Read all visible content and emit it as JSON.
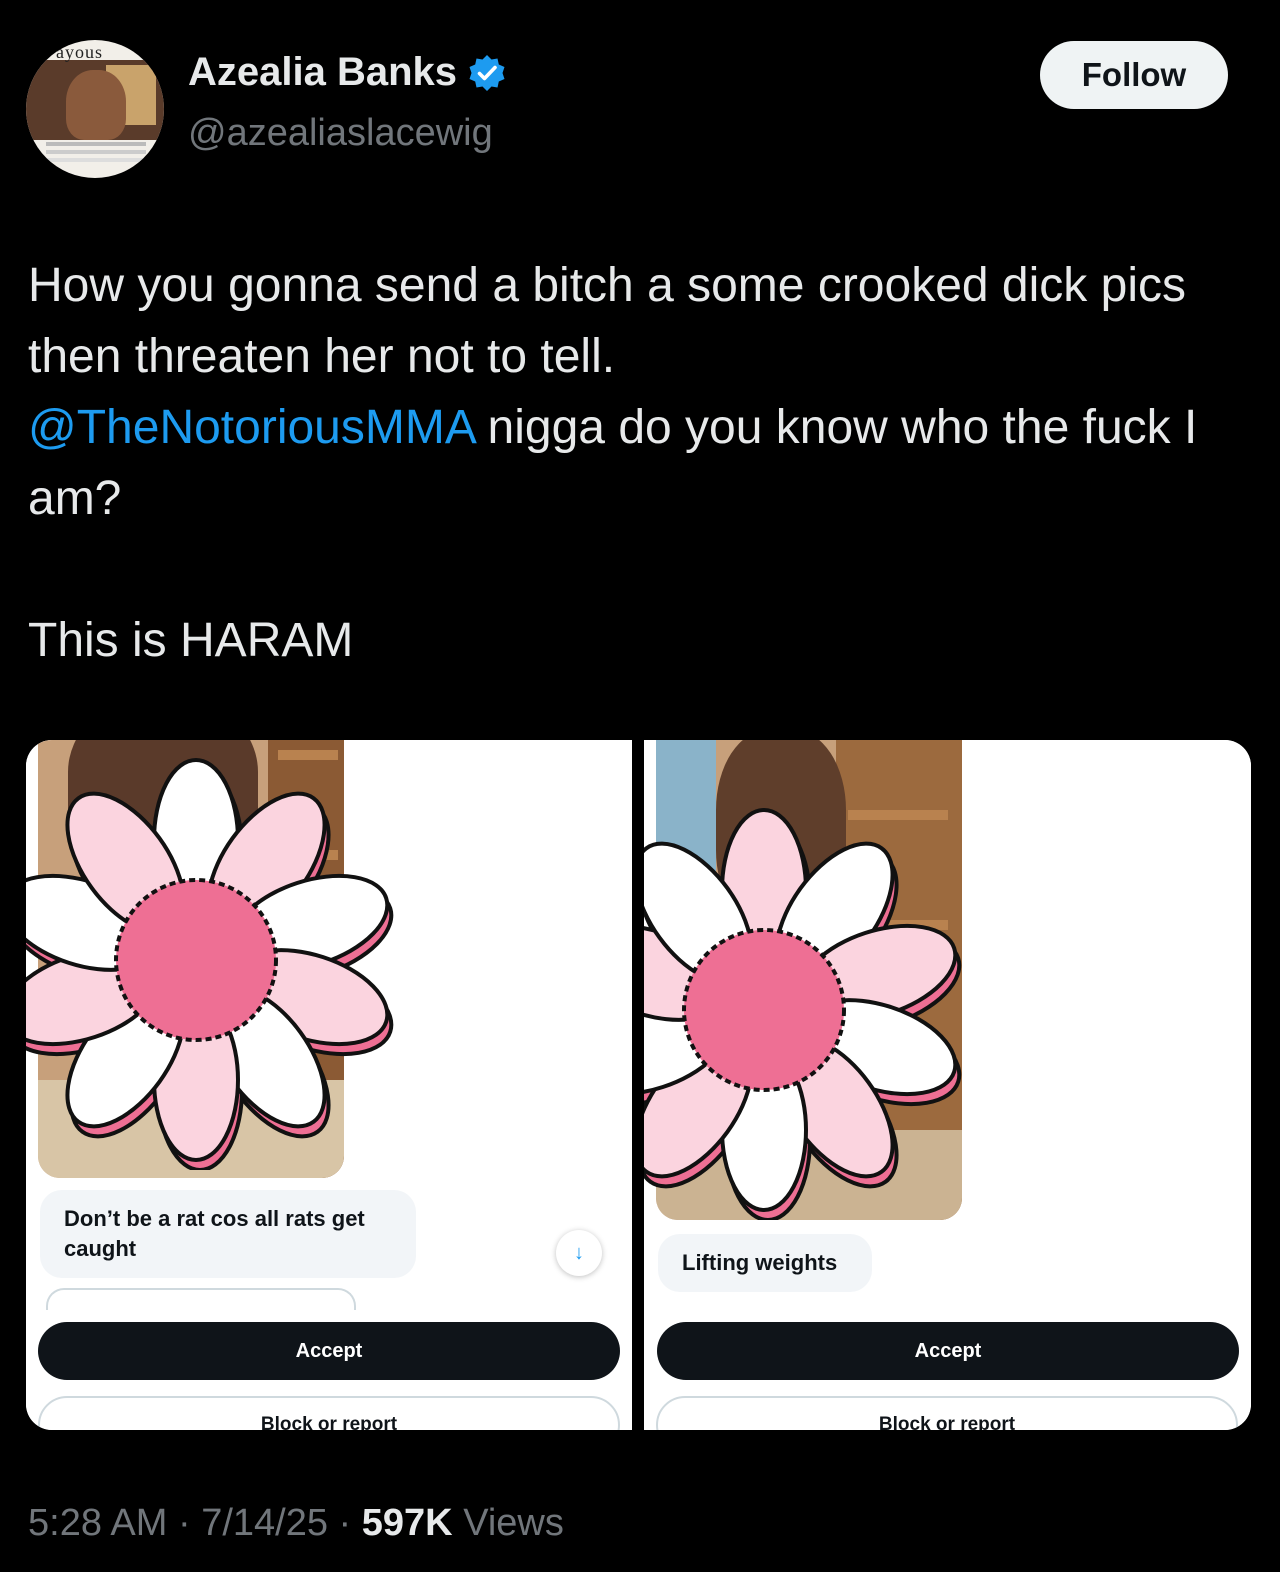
{
  "author": {
    "name": "Azealia Banks",
    "handle": "@azealiaslacewig",
    "avatar_icon": "profile-photo",
    "avatar_text": "ayous",
    "verified": true,
    "verified_color": "#1d9bf0"
  },
  "follow_label": "Follow",
  "tweet": {
    "line1": "How you gonna send a bitch a some crooked dick pics then threaten her not to tell.",
    "mention": "@TheNotoriousMMA",
    "line2": " nigga do you know who the fuck I am?",
    "line3": "This is HARAM"
  },
  "media": {
    "left": {
      "message": "Don’t be a rat cos all rats get caught",
      "accept_label": "Accept",
      "block_label": "Block or report",
      "scroll_icon": "arrow-down-icon"
    },
    "right": {
      "message": "Lifting weights",
      "accept_label": "Accept",
      "block_label": "Block or report"
    },
    "censor_icon": "flower-sticker-icon"
  },
  "meta": {
    "time": "5:28 AM",
    "date": "7/14/25",
    "views_count": "597K",
    "views_label": "Views",
    "separator": " · "
  },
  "colors": {
    "background": "#000000",
    "text": "#e7e9ea",
    "secondary_text": "#71767b",
    "link": "#1d9bf0",
    "flower_center": "#ee6f94",
    "flower_petal_light": "#fbd4df",
    "flower_petal_white": "#ffffff"
  }
}
